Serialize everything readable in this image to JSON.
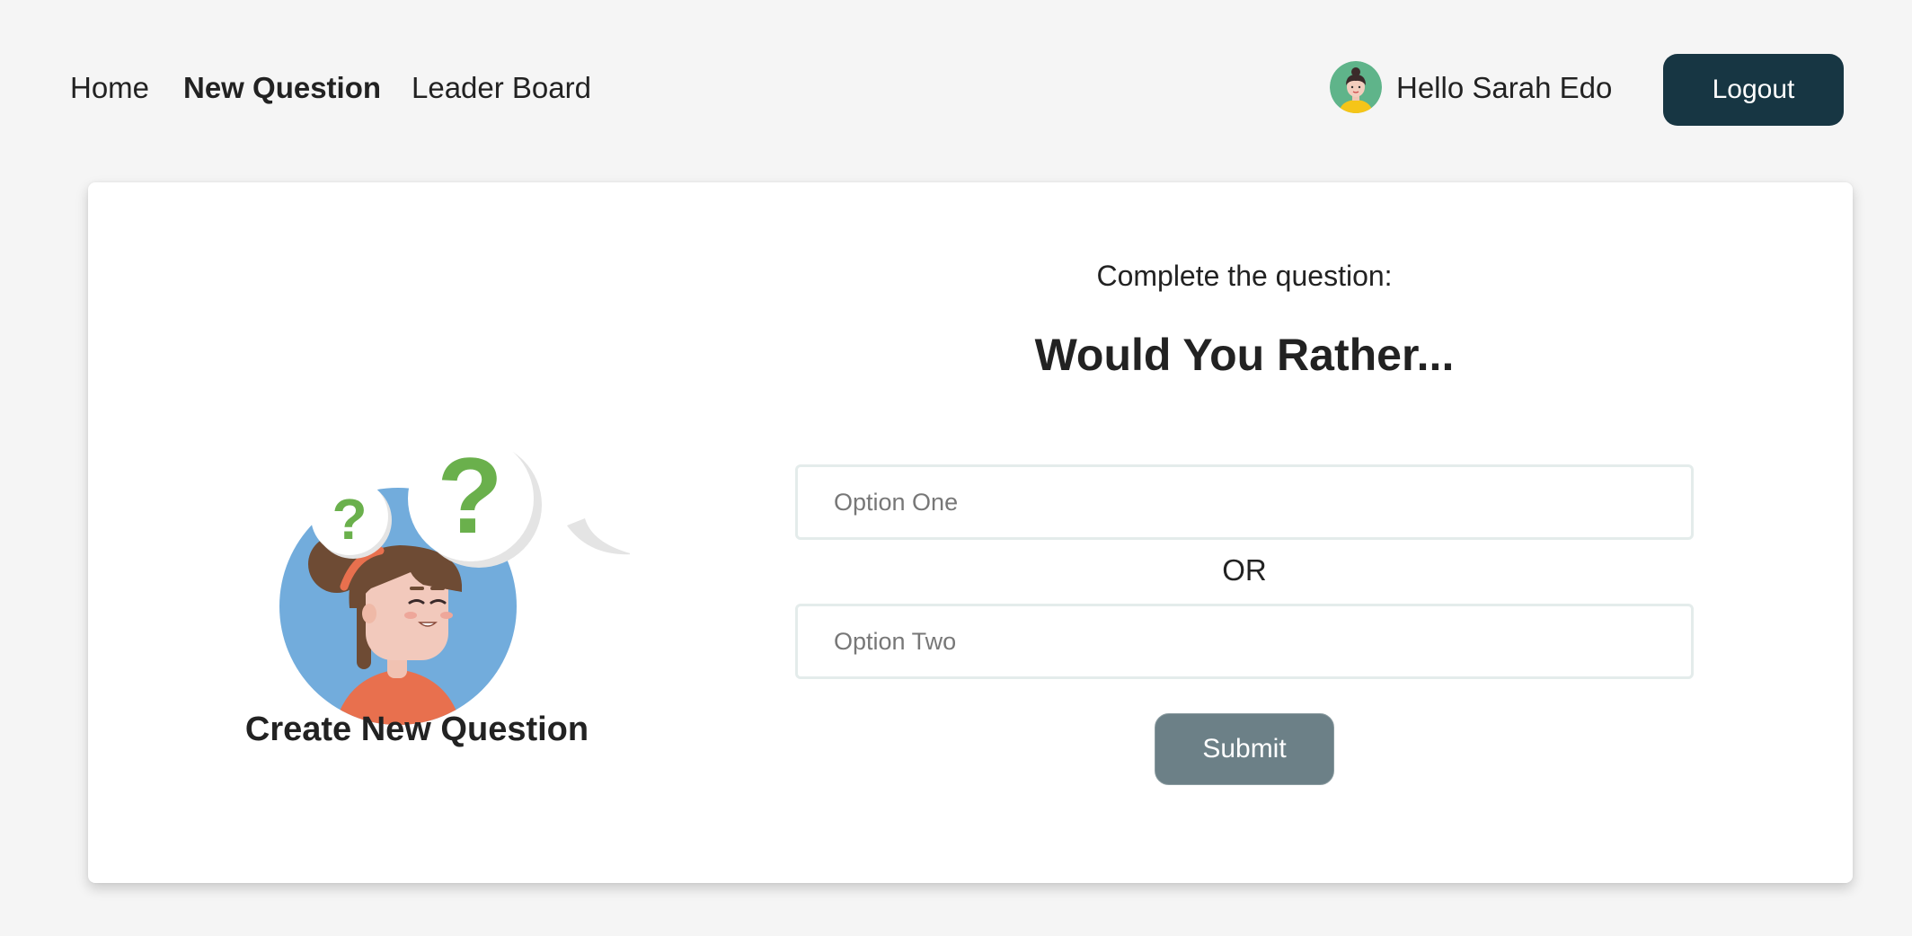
{
  "nav": {
    "home_label": "Home",
    "new_question_label": "New Question",
    "leader_board_label": "Leader Board",
    "active_item": "New Question"
  },
  "user": {
    "greeting": "Hello Sarah Edo",
    "avatar_icon": "user-avatar-icon"
  },
  "header": {
    "logout_label": "Logout"
  },
  "card": {
    "left_title": "Create New Question",
    "illustration": "thinking-person-with-question-marks-illustration",
    "instruction": "Complete the question:",
    "title": "Would You Rather...",
    "option_one_placeholder": "Option One",
    "option_one_value": "",
    "or_label": "OR",
    "option_two_placeholder": "Option Two",
    "option_two_value": "",
    "submit_label": "Submit"
  },
  "colors": {
    "page_background": "#f5f5f5",
    "logout_button": "#173643",
    "submit_button": "#6c8087",
    "input_border": "#e4eceb",
    "illustration_circle": "#72acdc",
    "question_mark_green": "#6ab04c"
  }
}
